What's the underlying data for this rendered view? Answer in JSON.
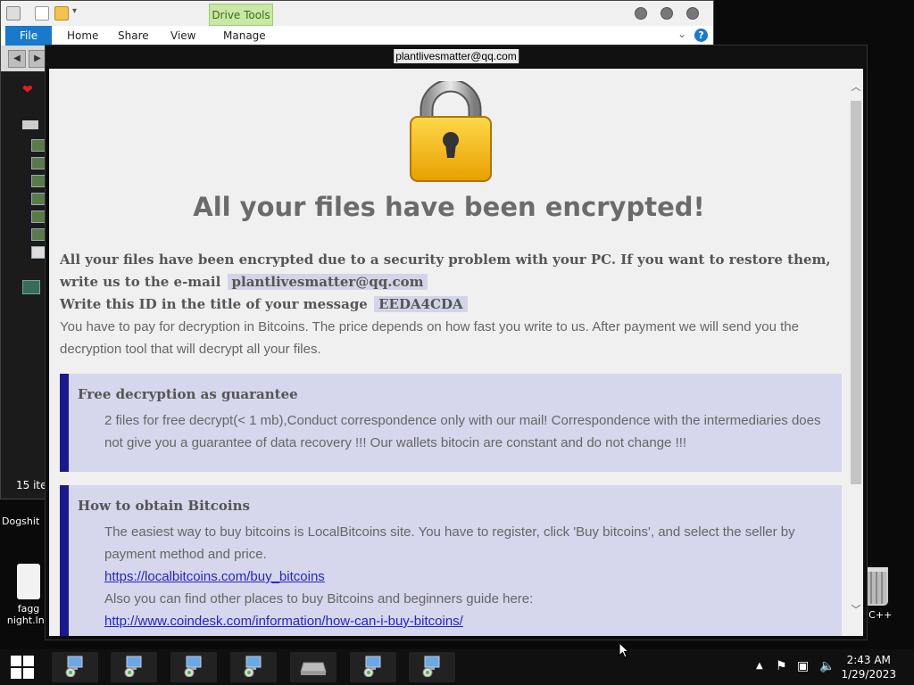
{
  "explorer": {
    "context_tab": "Drive Tools",
    "ribbon_tabs": [
      "File",
      "Home",
      "Share",
      "View",
      "Manage"
    ],
    "items_count": "15 ite"
  },
  "desktop_icons": [
    {
      "label": "Dogshit"
    },
    {
      "label_line1": "fagg",
      "label_line2": "night.lnk"
    },
    {
      "label": "n C++"
    }
  ],
  "ransom": {
    "title": "plantlivesmatter@qq.com",
    "headline": "All your files have been encrypted!",
    "intro": "All your files have been encrypted due to a security problem with your PC. If you want to restore them, write us to the e-mail",
    "email": "plantlivesmatter@qq.com",
    "id_prompt": "Write this ID in the title of your message",
    "id": "EEDA4CDA",
    "payment": "You have to pay for decryption in Bitcoins. The price depends on how fast you write to us. After payment we will send you the decryption tool that will decrypt all your files.",
    "guarantee": {
      "title": "Free decryption as guarantee",
      "text": "2 files for free decrypt(< 1 mb),Conduct correspondence only with our mail! Correspondence with the intermediaries does not give you a guarantee of data recovery !!! Our wallets bitocin are constant and do not change !!!"
    },
    "bitcoins": {
      "title": "How to obtain Bitcoins",
      "text": "The easiest way to buy bitcoins is LocalBitcoins site. You have to register, click 'Buy bitcoins', and select the seller by payment method and price.",
      "link1": "https://localbitcoins.com/buy_bitcoins",
      "text2": "Also you can find other places to buy Bitcoins and beginners guide here:",
      "link2": "http://www.coindesk.com/information/how-can-i-buy-bitcoins/"
    }
  },
  "taskbar": {
    "time": "2:43 AM",
    "date": "1/29/2023",
    "tray_icons": [
      "chevron-up-icon",
      "flag-icon",
      "network-icon",
      "volume-icon"
    ]
  },
  "colors": {
    "accent_box": "#d6d6ec",
    "box_border": "#1a1a8c",
    "headline": "#6b6b6b",
    "link": "#2525c4",
    "file_tab": "#1979ca"
  }
}
